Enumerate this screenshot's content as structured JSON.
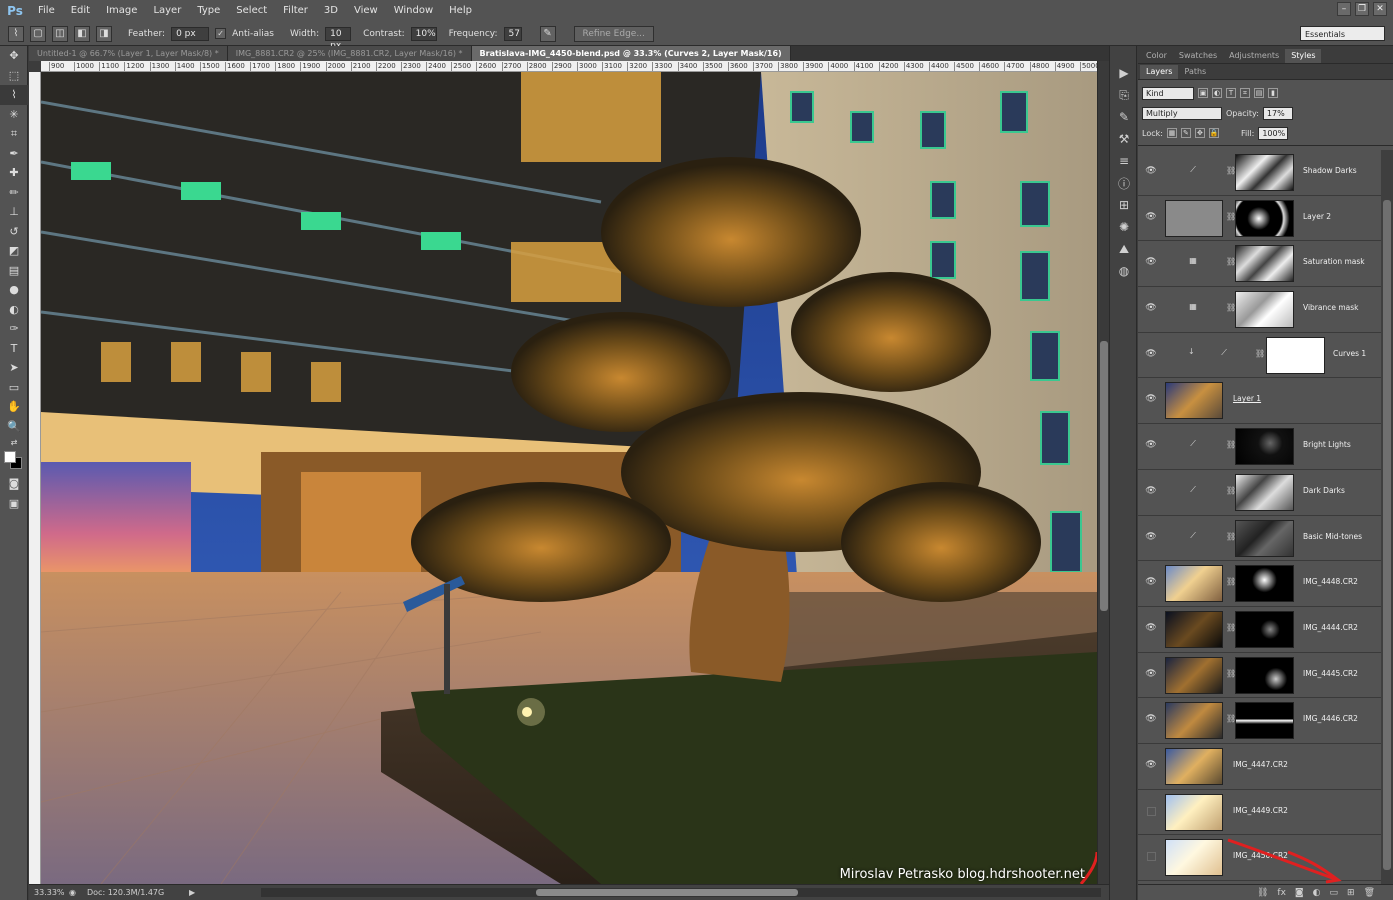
{
  "app": {
    "logo": "Ps"
  },
  "menu": [
    "File",
    "Edit",
    "Image",
    "Layer",
    "Type",
    "Select",
    "Filter",
    "3D",
    "View",
    "Window",
    "Help"
  ],
  "window_controls": {
    "minimize": "–",
    "restore": "❐",
    "close": "✕"
  },
  "options": {
    "feather_label": "Feather:",
    "feather_value": "0 px",
    "antialias_label": "Anti-alias",
    "width_label": "Width:",
    "width_value": "10 px",
    "contrast_label": "Contrast:",
    "contrast_value": "10%",
    "frequency_label": "Frequency:",
    "frequency_value": "57",
    "refine_edge": "Refine Edge...",
    "workspace": "Essentials"
  },
  "doc_tabs": [
    "Untitled-1 @ 66.7% (Layer 1, Layer Mask/8) *",
    "IMG_8881.CR2 @ 25% (IMG_8881.CR2, Layer Mask/16) *",
    "Bratislava-IMG_4450-blend.psd @ 33.3% (Curves 2, Layer Mask/16)"
  ],
  "ruler_ticks": [
    "900",
    "1000",
    "1100",
    "1200",
    "1300",
    "1400",
    "1500",
    "1600",
    "1700",
    "1800",
    "1900",
    "2000",
    "2100",
    "2200",
    "2300",
    "2400",
    "2500",
    "2600",
    "2700",
    "2800",
    "2900",
    "3000",
    "3100",
    "3200",
    "3300",
    "3400",
    "3500",
    "3600",
    "3700",
    "3800",
    "3900",
    "4000",
    "4100",
    "4200",
    "4300",
    "4400",
    "4500",
    "4600",
    "4700",
    "4800",
    "4900",
    "5000"
  ],
  "watermark": "Miroslav Petrasko blog.hdrshooter.net",
  "status": {
    "zoom": "33.33%",
    "doc": "Doc: 120.3M/1.47G"
  },
  "panel_tabs_top": [
    "Color",
    "Swatches",
    "Adjustments",
    "Styles"
  ],
  "panel_tabs_layers": [
    "Layers",
    "Paths"
  ],
  "layers_toolbar": {
    "kind": "Kind",
    "blend_mode": "Multiply",
    "opacity_label": "Opacity:",
    "opacity_value": "17%",
    "lock_label": "Lock:",
    "fill_label": "Fill:",
    "fill_value": "100%"
  },
  "layers": [
    {
      "name": "Shadow Darks",
      "type": "curves-masked",
      "visible": true
    },
    {
      "name": "Layer 2",
      "type": "pixel-masked",
      "visible": true
    },
    {
      "name": "Saturation mask",
      "type": "hue-masked",
      "visible": true
    },
    {
      "name": "Vibrance mask",
      "type": "hue-masked",
      "visible": true
    },
    {
      "name": "Curves 1",
      "type": "curves-clipped",
      "visible": true
    },
    {
      "name": "Layer 1",
      "type": "pixel",
      "visible": true
    },
    {
      "name": "Bright Lights",
      "type": "curves-masked",
      "visible": true
    },
    {
      "name": "Dark Darks",
      "type": "curves-masked",
      "visible": true
    },
    {
      "name": "Basic Mid-tones",
      "type": "curves-masked",
      "visible": true
    },
    {
      "name": "IMG_4448.CR2",
      "type": "pixel-masked",
      "visible": true
    },
    {
      "name": "IMG_4444.CR2",
      "type": "pixel-masked",
      "visible": true
    },
    {
      "name": "IMG_4445.CR2",
      "type": "pixel-masked",
      "visible": true
    },
    {
      "name": "IMG_4446.CR2",
      "type": "pixel-masked",
      "visible": true
    },
    {
      "name": "IMG_4447.CR2",
      "type": "pixel",
      "visible": true
    },
    {
      "name": "IMG_4449.CR2",
      "type": "pixel",
      "visible": false
    },
    {
      "name": "IMG_4450.CR2",
      "type": "pixel",
      "visible": false
    }
  ],
  "colors": {
    "accent_arrow": "#e02020",
    "panel_bg": "#535353",
    "canvas_warm": "#e0a040"
  }
}
